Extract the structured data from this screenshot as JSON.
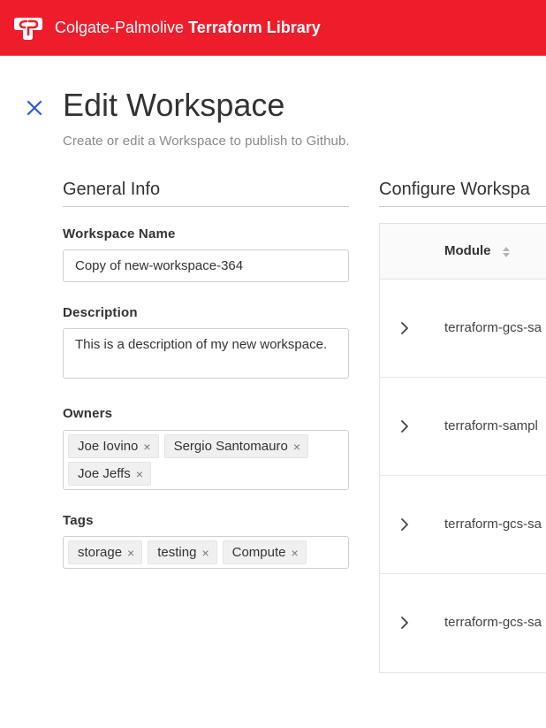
{
  "header": {
    "logo_icon": "colgate-palmolive-logo-icon",
    "brand_regular": "Colgate-Palmolive",
    "brand_bold": "Terraform Library",
    "brand_color": "#ee1d2c"
  },
  "page": {
    "close_icon": "close-icon",
    "title": "Edit Workspace",
    "subtitle": "Create or edit a Workspace to publish to Github."
  },
  "general_info": {
    "section_title": "General Info",
    "workspace_name": {
      "label": "Workspace Name",
      "value": "Copy of new-workspace-364"
    },
    "description": {
      "label": "Description",
      "value": "This is a description of my new workspace."
    },
    "owners": {
      "label": "Owners",
      "items": [
        "Joe Iovino",
        "Sergio Santomauro",
        "Joe Jeffs"
      ]
    },
    "tags": {
      "label": "Tags",
      "items": [
        "storage",
        "testing",
        "Compute"
      ]
    },
    "remove_glyph": "×"
  },
  "configure": {
    "section_title": "Configure Workspa",
    "table": {
      "column_module": "Module",
      "sort_icon": "sort-icon",
      "expand_icon": "chevron-right-icon",
      "rows": [
        {
          "module": "terraform-gcs-sa"
        },
        {
          "module": "terraform-sampl"
        },
        {
          "module": "terraform-gcs-sa"
        },
        {
          "module": "terraform-gcs-sa"
        }
      ]
    }
  }
}
